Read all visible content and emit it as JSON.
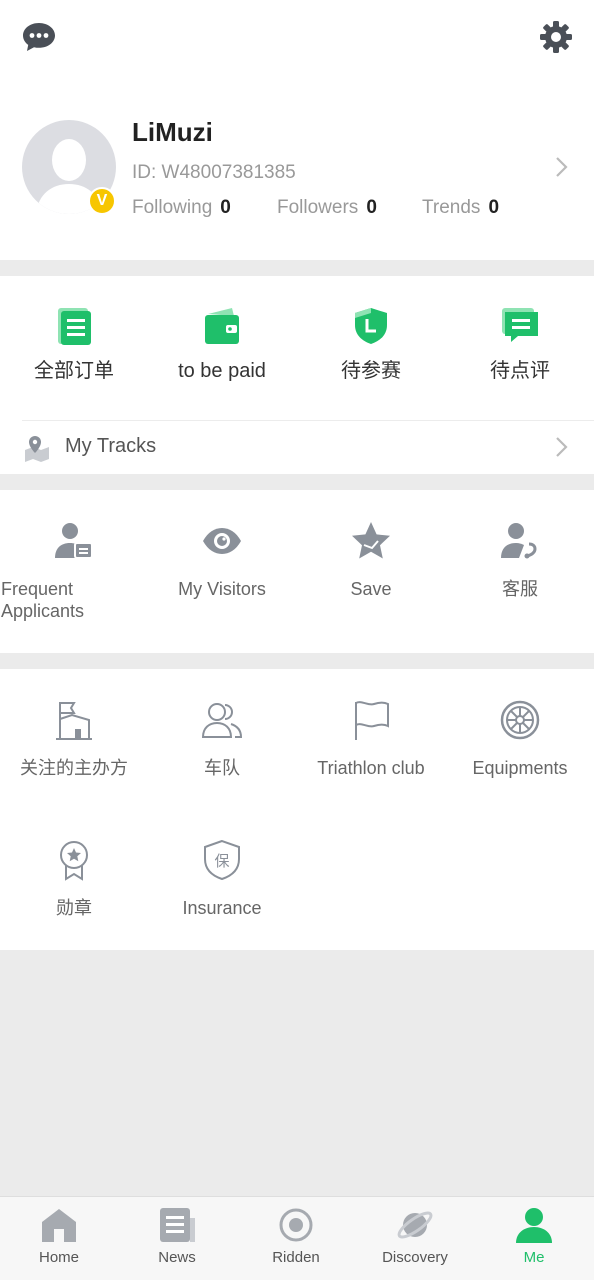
{
  "profile": {
    "name": "LiMuzi",
    "id_text": "ID: W48007381385",
    "badge": "V",
    "stats": [
      {
        "label": "Following",
        "value": "0"
      },
      {
        "label": "Followers",
        "value": "0"
      },
      {
        "label": "Trends",
        "value": "0"
      }
    ]
  },
  "orders": [
    {
      "label": "全部订单",
      "icon": "order-list-icon"
    },
    {
      "label": "to be paid",
      "icon": "wallet-icon"
    },
    {
      "label": "待参赛",
      "icon": "shield-l-icon"
    },
    {
      "label": "待点评",
      "icon": "comment-icon"
    }
  ],
  "tracks": {
    "label": "My Tracks",
    "icon": "map-pin-icon"
  },
  "utilities": [
    {
      "label": "Frequent\nApplicants",
      "icon": "applicant-card-icon"
    },
    {
      "label": "My Visitors",
      "icon": "eye-icon"
    },
    {
      "label": "Save",
      "icon": "star-icon"
    },
    {
      "label": "客服",
      "icon": "customer-service-icon"
    }
  ],
  "more": [
    {
      "label": "关注的主办方",
      "icon": "organizer-flag-icon"
    },
    {
      "label": "车队",
      "icon": "team-icon"
    },
    {
      "label": "Triathlon club",
      "icon": "flag-icon"
    },
    {
      "label": "Equipments",
      "icon": "wheel-icon"
    },
    {
      "label": "勋章",
      "icon": "medal-icon"
    },
    {
      "label": "Insurance",
      "icon": "insurance-shield-icon"
    }
  ],
  "tabs": [
    {
      "label": "Home",
      "icon": "home-icon"
    },
    {
      "label": "News",
      "icon": "news-icon"
    },
    {
      "label": "Ridden",
      "icon": "ridden-icon"
    },
    {
      "label": "Discovery",
      "icon": "discovery-icon"
    },
    {
      "label": "Me",
      "icon": "me-icon",
      "active": true
    }
  ],
  "colors": {
    "accent": "#1fbf6a",
    "badge": "#f7c600",
    "icon_gray": "#8a9099"
  }
}
